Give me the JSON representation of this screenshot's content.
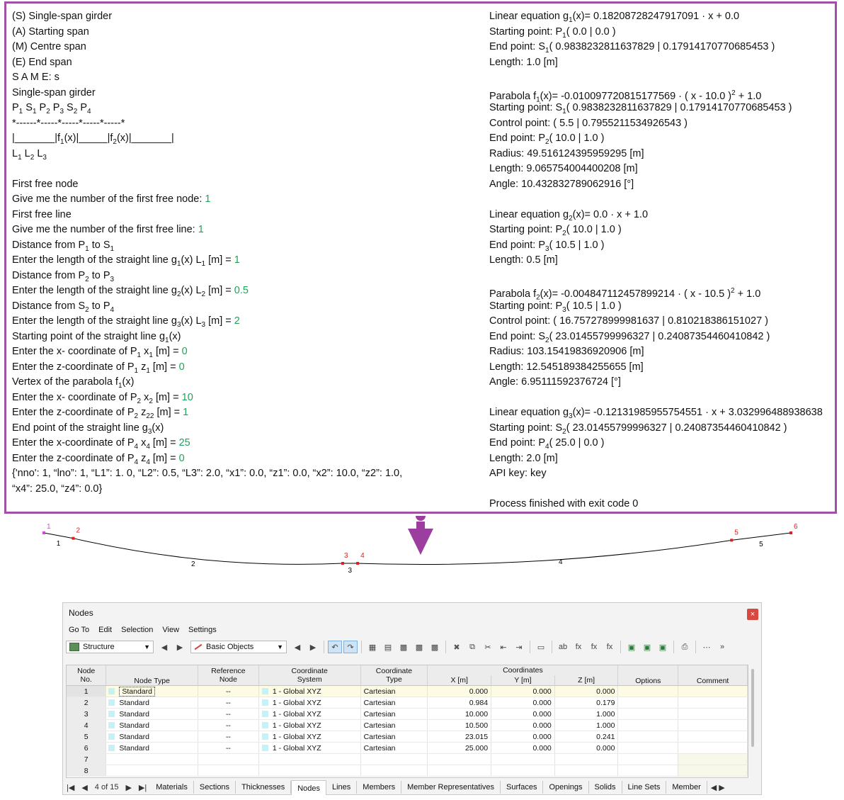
{
  "console": {
    "left": [
      "(S) Single-span girder",
      "(A) Starting span",
      "(M) Centre span",
      "(E) End span",
      "S A M E: s",
      "Single-span girder",
      {
        "segs": [
          [
            "P",
            ""
          ],
          [
            "1",
            "sub"
          ],
          [
            " S",
            ""
          ],
          [
            "1",
            "sub"
          ],
          [
            " P",
            ""
          ],
          [
            "2",
            "sub"
          ],
          [
            " P",
            ""
          ],
          [
            "3",
            "sub"
          ],
          [
            " S",
            ""
          ],
          [
            "2",
            "sub"
          ],
          [
            " P",
            ""
          ],
          [
            "4",
            "sub"
          ]
        ]
      },
      "*------*-----*-----*-----*-----*",
      {
        "segs": [
          [
            "|_______|f",
            ""
          ],
          [
            "1",
            "sub"
          ],
          [
            "(x)|_____|f",
            ""
          ],
          [
            "2",
            "sub"
          ],
          [
            "(x)|_______|",
            ""
          ]
        ]
      },
      {
        "segs": [
          [
            " L",
            ""
          ],
          [
            "1",
            "sub"
          ],
          [
            " L",
            ""
          ],
          [
            "2",
            "sub"
          ],
          [
            " L",
            ""
          ],
          [
            "3",
            "sub"
          ]
        ]
      },
      "",
      "First free node",
      {
        "segs": [
          [
            "Give me the number of the first free node: ",
            ""
          ],
          [
            "1",
            "inp"
          ]
        ]
      },
      "First free line",
      {
        "segs": [
          [
            "Give me the number of the first free line: ",
            ""
          ],
          [
            "1",
            "inp"
          ]
        ]
      },
      {
        "segs": [
          [
            "Distance from P",
            ""
          ],
          [
            "1",
            "sub"
          ],
          [
            " to S",
            ""
          ],
          [
            "1",
            "sub"
          ]
        ]
      },
      {
        "segs": [
          [
            "Enter the length of the straight line g",
            ""
          ],
          [
            "1",
            "sub"
          ],
          [
            "(x) L",
            ""
          ],
          [
            "1",
            "sub"
          ],
          [
            " [m] = ",
            ""
          ],
          [
            "1",
            "inp"
          ]
        ]
      },
      {
        "segs": [
          [
            "Distance from P",
            ""
          ],
          [
            "2",
            "sub"
          ],
          [
            " to P",
            ""
          ],
          [
            "3",
            "sub"
          ]
        ]
      },
      {
        "segs": [
          [
            "Enter the length of the straight line g",
            ""
          ],
          [
            "2",
            "sub"
          ],
          [
            "(x) L",
            ""
          ],
          [
            "2",
            "sub"
          ],
          [
            " [m] = ",
            ""
          ],
          [
            "0.5",
            "inp"
          ]
        ]
      },
      {
        "segs": [
          [
            "Distance from S",
            ""
          ],
          [
            "2",
            "sub"
          ],
          [
            " to P",
            ""
          ],
          [
            "4",
            "sub"
          ]
        ]
      },
      {
        "segs": [
          [
            "Enter the length of the straight line g",
            ""
          ],
          [
            "3",
            "sub"
          ],
          [
            "(x) L",
            ""
          ],
          [
            "3",
            "sub"
          ],
          [
            " [m] = ",
            ""
          ],
          [
            "2",
            "inp"
          ]
        ]
      },
      {
        "segs": [
          [
            "Starting point of the straight line g",
            ""
          ],
          [
            "1",
            "sub"
          ],
          [
            "(x)",
            ""
          ]
        ]
      },
      {
        "segs": [
          [
            "Enter the x- coordinate of P",
            ""
          ],
          [
            "1",
            "sub"
          ],
          [
            " x",
            ""
          ],
          [
            "1",
            "sub"
          ],
          [
            " [m] = ",
            ""
          ],
          [
            "0",
            "inp"
          ]
        ]
      },
      {
        "segs": [
          [
            "Enter the z-coordinate of P",
            ""
          ],
          [
            "1",
            "sub"
          ],
          [
            " z",
            ""
          ],
          [
            "1",
            "sub"
          ],
          [
            " [m] = ",
            ""
          ],
          [
            "0",
            "inp"
          ]
        ]
      },
      {
        "segs": [
          [
            "Vertex of the parabola f",
            ""
          ],
          [
            "1",
            "sub"
          ],
          [
            "(x)",
            ""
          ]
        ]
      },
      {
        "segs": [
          [
            "Enter the x- coordinate of P",
            ""
          ],
          [
            "2",
            "sub"
          ],
          [
            " x",
            ""
          ],
          [
            "2",
            "sub"
          ],
          [
            " [m] = ",
            ""
          ],
          [
            "10",
            "inp"
          ]
        ]
      },
      {
        "segs": [
          [
            "Enter the z-coordinate of P",
            ""
          ],
          [
            "2",
            "sub"
          ],
          [
            " z",
            ""
          ],
          [
            "22",
            "sub"
          ],
          [
            " [m] = ",
            ""
          ],
          [
            "1",
            "inp"
          ]
        ]
      },
      {
        "segs": [
          [
            "End point of the straight line g",
            ""
          ],
          [
            "3",
            "sub"
          ],
          [
            "(x)",
            ""
          ]
        ]
      },
      {
        "segs": [
          [
            "Enter the x-coordinate of P",
            ""
          ],
          [
            "4",
            "sub"
          ],
          [
            " x",
            ""
          ],
          [
            "4",
            "sub"
          ],
          [
            " [m] = ",
            ""
          ],
          [
            "25",
            "inp"
          ]
        ]
      },
      {
        "segs": [
          [
            "Enter the z-coordinate of P",
            ""
          ],
          [
            "4",
            "sub"
          ],
          [
            " z",
            ""
          ],
          [
            "4",
            "sub"
          ],
          [
            " [m] = ",
            ""
          ],
          [
            "0",
            "inp"
          ]
        ]
      },
      "{'nno': 1, “lno”: 1, “L1”: 1. 0, “L2”: 0.5, “L3”: 2.0, “x1”: 0.0, “z1”: 0.0, “x2”: 10.0, “z2”: 1.0,",
      "“x4”: 25.0, “z4”: 0.0}"
    ],
    "right": [
      {
        "segs": [
          [
            "Linear equation g",
            ""
          ],
          [
            "1",
            "sub"
          ],
          [
            "(x)= 0.18208728247917091 · x + 0.0",
            ""
          ]
        ]
      },
      {
        "segs": [
          [
            "Starting point: P",
            ""
          ],
          [
            "1",
            "sub"
          ],
          [
            "( 0.0 | 0.0 )",
            ""
          ]
        ]
      },
      {
        "segs": [
          [
            "End point: S",
            ""
          ],
          [
            "1",
            "sub"
          ],
          [
            "( 0.9838232811637829 | 0.17914170770685453 )",
            ""
          ]
        ]
      },
      "Length: 1.0 [m]",
      "",
      {
        "segs": [
          [
            "Parabola f",
            ""
          ],
          [
            "1",
            "sub"
          ],
          [
            "(x)= -0.010097720815177569 · ( x - 10.0 )",
            ""
          ],
          [
            "2",
            "sup"
          ],
          [
            " + 1.0",
            ""
          ]
        ]
      },
      {
        "segs": [
          [
            "Starting point: S",
            ""
          ],
          [
            "1",
            "sub"
          ],
          [
            "( 0.9838232811637829 | 0.17914170770685453 )",
            ""
          ]
        ]
      },
      "Control point: ( 5.5 | 0.7955211534926543 )",
      {
        "segs": [
          [
            "End point: P",
            ""
          ],
          [
            "2",
            "sub"
          ],
          [
            "( 10.0 | 1.0 )",
            ""
          ]
        ]
      },
      "Radius: 49.516124395959295 [m]",
      "Length: 9.065754004400208 [m]",
      "Angle: 10.432832789062916 [°]",
      "",
      {
        "segs": [
          [
            "Linear equation g",
            ""
          ],
          [
            "2",
            "sub"
          ],
          [
            "(x)= 0.0 · x + 1.0",
            ""
          ]
        ]
      },
      {
        "segs": [
          [
            "Starting point: P",
            ""
          ],
          [
            "2",
            "sub"
          ],
          [
            "( 10.0 | 1.0 )",
            ""
          ]
        ]
      },
      {
        "segs": [
          [
            "End point: P",
            ""
          ],
          [
            "3",
            "sub"
          ],
          [
            "( 10.5 | 1.0 )",
            ""
          ]
        ]
      },
      "Length: 0.5 [m]",
      "",
      {
        "segs": [
          [
            "Parabola f",
            ""
          ],
          [
            "2",
            "sub"
          ],
          [
            "(x)= -0.004847112457899214 · ( x - 10.5 )",
            ""
          ],
          [
            "2",
            "sup"
          ],
          [
            " + 1.0",
            ""
          ]
        ]
      },
      {
        "segs": [
          [
            "Starting point: P",
            ""
          ],
          [
            "3",
            "sub"
          ],
          [
            "( 10.5 | 1.0 )",
            ""
          ]
        ]
      },
      "Control point: ( 16.757278999981637 | 0.810218386151027 )",
      {
        "segs": [
          [
            "End point: S",
            ""
          ],
          [
            "2",
            "sub"
          ],
          [
            "( 23.01455799996327 | 0.24087354460410842 )",
            ""
          ]
        ]
      },
      "Radius: 103.15419836920906 [m]",
      "Length: 12.545189384255655 [m]",
      "Angle: 6.95111592376724 [°]",
      "",
      {
        "segs": [
          [
            "Linear equation g",
            ""
          ],
          [
            "3",
            "sub"
          ],
          [
            "(x)= -0.12131985955754551 · x + 3.032996488938638",
            ""
          ]
        ]
      },
      {
        "segs": [
          [
            "Starting point: S",
            ""
          ],
          [
            "2",
            "sub"
          ],
          [
            "( 23.01455799996327 | 0.24087354460410842 )",
            ""
          ]
        ]
      },
      {
        "segs": [
          [
            "End point: P",
            ""
          ],
          [
            "4",
            "sub"
          ],
          [
            "( 25.0 | 0.0 )",
            ""
          ]
        ]
      },
      "Length: 2.0 [m]",
      "API key: key",
      "",
      "Process finished with exit code 0"
    ]
  },
  "structure": {
    "node_labels": [
      "1",
      "2",
      "3",
      "4",
      "5",
      "6"
    ],
    "line_labels": [
      "1",
      "2",
      "3",
      "4",
      "5"
    ],
    "colors": {
      "node_first": "#e040e0",
      "node": "#e02020",
      "line": "#000000",
      "arrow": "#9b3ea0"
    }
  },
  "nodes_window": {
    "title": "Nodes",
    "close_glyph": "×",
    "menu": [
      "Go To",
      "Edit",
      "Selection",
      "View",
      "Settings"
    ],
    "structure_combo": "Structure",
    "objects_combo": "Basic Objects",
    "toolbar_icons": [
      "select-left-icon",
      "select-right-icon",
      "table-icon",
      "table-edit-icon",
      "grid-icon",
      "grid2-icon",
      "grid3-icon",
      "delete-icon",
      "copy-icon",
      "cut-icon",
      "paste-left-icon",
      "paste-right-icon",
      "panel-icon",
      "ab-icon",
      "fx-icon",
      "fx-clear-icon",
      "fx-star-icon",
      "excel-icon",
      "excel-import-icon",
      "excel-export-icon",
      "print-icon",
      "xyz-icon"
    ],
    "headers": {
      "node_no": [
        "Node",
        "No."
      ],
      "node_type": "Node Type",
      "reference_node": [
        "Reference",
        "Node"
      ],
      "coord_system": [
        "Coordinate",
        "System"
      ],
      "coord_type": [
        "Coordinate",
        "Type"
      ],
      "coordinates": "Coordinates",
      "x": "X [m]",
      "y": "Y [m]",
      "z": "Z [m]",
      "options": "Options",
      "comment": "Comment"
    },
    "rows": [
      {
        "no": "1",
        "type": "Standard",
        "ref": "--",
        "cs": "1 - Global XYZ",
        "ct": "Cartesian",
        "x": "0.000",
        "y": "0.000",
        "z": "0.000"
      },
      {
        "no": "2",
        "type": "Standard",
        "ref": "--",
        "cs": "1 - Global XYZ",
        "ct": "Cartesian",
        "x": "0.984",
        "y": "0.000",
        "z": "0.179"
      },
      {
        "no": "3",
        "type": "Standard",
        "ref": "--",
        "cs": "1 - Global XYZ",
        "ct": "Cartesian",
        "x": "10.000",
        "y": "0.000",
        "z": "1.000"
      },
      {
        "no": "4",
        "type": "Standard",
        "ref": "--",
        "cs": "1 - Global XYZ",
        "ct": "Cartesian",
        "x": "10.500",
        "y": "0.000",
        "z": "1.000"
      },
      {
        "no": "5",
        "type": "Standard",
        "ref": "--",
        "cs": "1 - Global XYZ",
        "ct": "Cartesian",
        "x": "23.015",
        "y": "0.000",
        "z": "0.241"
      },
      {
        "no": "6",
        "type": "Standard",
        "ref": "--",
        "cs": "1 - Global XYZ",
        "ct": "Cartesian",
        "x": "25.000",
        "y": "0.000",
        "z": "0.000"
      },
      {
        "no": "7",
        "type": "",
        "ref": "",
        "cs": "",
        "ct": "",
        "x": "",
        "y": "",
        "z": ""
      },
      {
        "no": "8",
        "type": "",
        "ref": "",
        "cs": "",
        "ct": "",
        "x": "",
        "y": "",
        "z": ""
      }
    ],
    "pager": "4 of 15",
    "tabs": [
      "Materials",
      "Sections",
      "Thicknesses",
      "Nodes",
      "Lines",
      "Members",
      "Member Representatives",
      "Surfaces",
      "Openings",
      "Solids",
      "Line Sets",
      "Member"
    ],
    "active_tab": "Nodes"
  }
}
